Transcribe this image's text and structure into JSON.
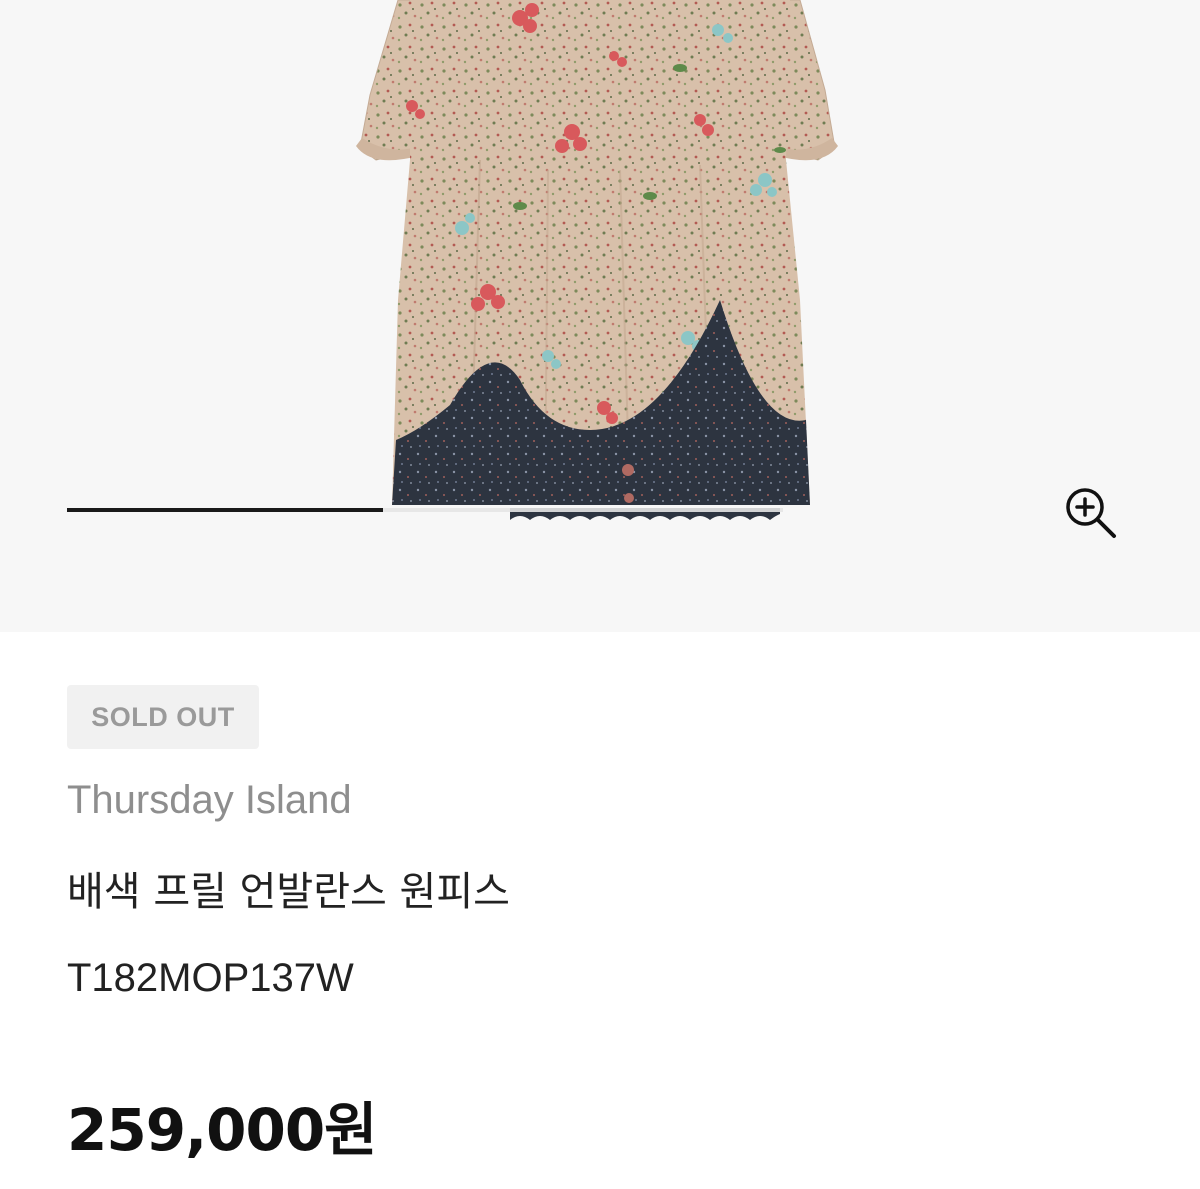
{
  "gallery": {
    "zoom_icon": "zoom-in-icon",
    "slide_count_shown": 1
  },
  "product": {
    "status_badge": "SOLD OUT",
    "brand": "Thursday Island",
    "name": "배색 프릴 언발란스 원피스",
    "code": "T182MOP137W",
    "price": "259,000원"
  },
  "colors": {
    "dress_base": "#d9c2ad",
    "dress_hem": "#2e3440",
    "indicator_active": "#1a1a1a",
    "badge_bg": "#f1f1f1",
    "badge_text": "#9a9a9a",
    "brand_text": "#8e8e8e",
    "text_dark": "#222222"
  }
}
